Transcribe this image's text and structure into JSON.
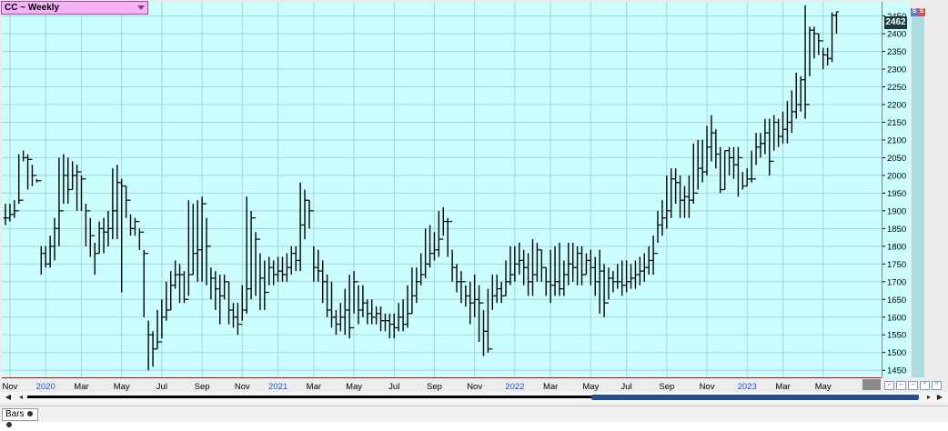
{
  "symbol": {
    "label": "CC ~ Weekly"
  },
  "last_price": "2462",
  "side_buttons": [
    "S",
    "S"
  ],
  "bottom_tab": {
    "label": "Bars"
  },
  "colors": {
    "plot_bg": "#ccfeff",
    "grid": "#9fd7d9",
    "bar": "#000000",
    "axis_line": "#cc0000",
    "year_label": "#1a56c8"
  },
  "chart_data": {
    "type": "ohlc",
    "title": "CC ~ Weekly",
    "ylim": [
      1430,
      2490
    ],
    "y_ticks": [
      1450,
      1500,
      1550,
      1600,
      1650,
      1700,
      1750,
      1800,
      1850,
      1900,
      1950,
      2000,
      2050,
      2100,
      2150,
      2200,
      2250,
      2300,
      2350,
      2400,
      2450
    ],
    "x_tick_labels": [
      {
        "label": "Nov",
        "week": 1,
        "year": false
      },
      {
        "label": "2020",
        "week": 9,
        "year": true
      },
      {
        "label": "Mar",
        "week": 17,
        "year": false
      },
      {
        "label": "May",
        "week": 26,
        "year": false
      },
      {
        "label": "Jul",
        "week": 35,
        "year": false
      },
      {
        "label": "Sep",
        "week": 44,
        "year": false
      },
      {
        "label": "Nov",
        "week": 53,
        "year": false
      },
      {
        "label": "2021",
        "week": 61,
        "year": true
      },
      {
        "label": "Mar",
        "week": 69,
        "year": false
      },
      {
        "label": "May",
        "week": 78,
        "year": false
      },
      {
        "label": "Jul",
        "week": 87,
        "year": false
      },
      {
        "label": "Sep",
        "week": 96,
        "year": false
      },
      {
        "label": "Nov",
        "week": 105,
        "year": false
      },
      {
        "label": "2022",
        "week": 114,
        "year": true
      },
      {
        "label": "Mar",
        "week": 122,
        "year": false
      },
      {
        "label": "May",
        "week": 131,
        "year": false
      },
      {
        "label": "Jul",
        "week": 139,
        "year": false
      },
      {
        "label": "Sep",
        "week": 148,
        "year": false
      },
      {
        "label": "Nov",
        "week": 157,
        "year": false
      },
      {
        "label": "2023",
        "week": 166,
        "year": true
      },
      {
        "label": "Mar",
        "week": 174,
        "year": false
      },
      {
        "label": "May",
        "week": 183,
        "year": false
      }
    ],
    "weeks_total": 192,
    "closes": [
      1880,
      1890,
      1900,
      1930,
      2050,
      2045,
      2000,
      1985,
      1780,
      1750,
      1800,
      1850,
      1900,
      2000,
      1960,
      2000,
      2010,
      1990,
      1900,
      1830,
      1780,
      1850,
      1840,
      1850,
      1900,
      1980,
      1970,
      1930,
      1850,
      1870,
      1840,
      1780,
      1550,
      1510,
      1530,
      1600,
      1620,
      1690,
      1720,
      1720,
      1650,
      1720,
      1780,
      1790,
      1920,
      1800,
      1710,
      1680,
      1660,
      1700,
      1620,
      1600,
      1580,
      1620,
      1680,
      1880,
      1820,
      1710,
      1670,
      1740,
      1720,
      1730,
      1720,
      1740,
      1780,
      1760,
      1860,
      1930,
      1900,
      1740,
      1730,
      1700,
      1620,
      1600,
      1580,
      1600,
      1620,
      1570,
      1700,
      1620,
      1640,
      1610,
      1600,
      1610,
      1590,
      1590,
      1580,
      1570,
      1600,
      1580,
      1610,
      1660,
      1700,
      1720,
      1750,
      1780,
      1790,
      1820,
      1870,
      1870,
      1740,
      1700,
      1700,
      1660,
      1640,
      1650,
      1640,
      1560,
      1510,
      1660,
      1680,
      1660,
      1700,
      1720,
      1750,
      1760,
      1740,
      1700,
      1720,
      1790,
      1740,
      1700,
      1690,
      1700,
      1680,
      1720,
      1750,
      1740,
      1780,
      1720,
      1760,
      1740,
      1700,
      1730,
      1640,
      1710,
      1700,
      1700,
      1690,
      1700,
      1710,
      1720,
      1730,
      1740,
      1760,
      1780,
      1860,
      1880,
      1900,
      1990,
      1980,
      1930,
      1940,
      1930,
      1950,
      2020,
      2010,
      2080,
      2120,
      2060,
      1960,
      2070,
      2050,
      2030,
      2050,
      1970,
      1990,
      1990,
      2080,
      2090,
      2120,
      2040,
      2150,
      2110,
      2130,
      2150,
      2180,
      2200,
      2270,
      2200,
      2410,
      2400,
      2380,
      2340,
      2330,
      2452,
      2462
    ],
    "highs": [
      1920,
      1920,
      1930,
      2060,
      2070,
      2060,
      2030,
      1990,
      1800,
      1800,
      1830,
      1880,
      2050,
      2060,
      2050,
      2040,
      2030,
      2000,
      1920,
      1880,
      1810,
      1870,
      1880,
      1900,
      2020,
      2030,
      1990,
      1970,
      1890,
      1880,
      1850,
      1790,
      1590,
      1560,
      1620,
      1650,
      1700,
      1730,
      1760,
      1750,
      1730,
      1930,
      1920,
      1930,
      1940,
      1880,
      1740,
      1730,
      1720,
      1720,
      1700,
      1640,
      1640,
      1690,
      1940,
      1900,
      1840,
      1780,
      1760,
      1770,
      1760,
      1770,
      1770,
      1780,
      1800,
      1800,
      1980,
      1960,
      1930,
      1800,
      1790,
      1760,
      1720,
      1700,
      1620,
      1640,
      1680,
      1720,
      1730,
      1690,
      1690,
      1650,
      1650,
      1630,
      1630,
      1610,
      1610,
      1610,
      1640,
      1650,
      1690,
      1740,
      1740,
      1780,
      1850,
      1860,
      1840,
      1900,
      1910,
      1880,
      1790,
      1750,
      1730,
      1690,
      1700,
      1720,
      1690,
      1620,
      1680,
      1720,
      1720,
      1700,
      1760,
      1800,
      1800,
      1810,
      1790,
      1780,
      1820,
      1810,
      1790,
      1740,
      1790,
      1800,
      1810,
      1760,
      1810,
      1810,
      1800,
      1800,
      1780,
      1790,
      1770,
      1790,
      1750,
      1740,
      1730,
      1750,
      1760,
      1760,
      1750,
      1760,
      1770,
      1780,
      1800,
      1830,
      1900,
      1930,
      2000,
      2020,
      2020,
      2000,
      1970,
      2000,
      2090,
      2100,
      2100,
      2140,
      2170,
      2130,
      2080,
      2070,
      2080,
      2080,
      2080,
      2010,
      2020,
      2070,
      2120,
      2120,
      2160,
      2160,
      2170,
      2160,
      2180,
      2210,
      2240,
      2290,
      2280,
      2480,
      2420,
      2420,
      2400,
      2360,
      2360,
      2460,
      2462
    ],
    "lows": [
      1860,
      1870,
      1880,
      1920,
      2040,
      1960,
      1970,
      1980,
      1720,
      1740,
      1740,
      1760,
      1800,
      1920,
      1920,
      1960,
      1900,
      1900,
      1800,
      1770,
      1720,
      1780,
      1780,
      1800,
      1820,
      1820,
      1670,
      1880,
      1830,
      1830,
      1790,
      1600,
      1450,
      1460,
      1510,
      1540,
      1590,
      1620,
      1680,
      1640,
      1640,
      1660,
      1720,
      1700,
      1700,
      1690,
      1650,
      1620,
      1580,
      1650,
      1580,
      1570,
      1550,
      1590,
      1610,
      1650,
      1660,
      1620,
      1620,
      1690,
      1690,
      1700,
      1700,
      1700,
      1720,
      1730,
      1730,
      1820,
      1850,
      1700,
      1700,
      1640,
      1600,
      1570,
      1550,
      1560,
      1550,
      1540,
      1610,
      1580,
      1600,
      1580,
      1580,
      1580,
      1560,
      1560,
      1540,
      1540,
      1560,
      1560,
      1570,
      1610,
      1640,
      1690,
      1710,
      1740,
      1760,
      1770,
      1830,
      1770,
      1700,
      1670,
      1640,
      1630,
      1580,
      1600,
      1530,
      1490,
      1500,
      1620,
      1640,
      1640,
      1660,
      1690,
      1700,
      1720,
      1690,
      1660,
      1660,
      1700,
      1700,
      1660,
      1640,
      1660,
      1660,
      1660,
      1690,
      1700,
      1690,
      1690,
      1720,
      1690,
      1660,
      1610,
      1600,
      1650,
      1670,
      1680,
      1660,
      1670,
      1680,
      1680,
      1690,
      1700,
      1720,
      1720,
      1810,
      1830,
      1850,
      1880,
      1920,
      1880,
      1880,
      1880,
      1920,
      1960,
      1980,
      2000,
      2040,
      2020,
      1950,
      1960,
      2000,
      1990,
      1940,
      1960,
      1970,
      1980,
      2030,
      2050,
      2060,
      2000,
      2070,
      2080,
      2090,
      2090,
      2120,
      2160,
      2180,
      2160,
      2280,
      2330,
      2340,
      2300,
      2310,
      2320,
      2400
    ],
    "series": [
      {
        "name": "CC ~ Weekly"
      }
    ]
  }
}
